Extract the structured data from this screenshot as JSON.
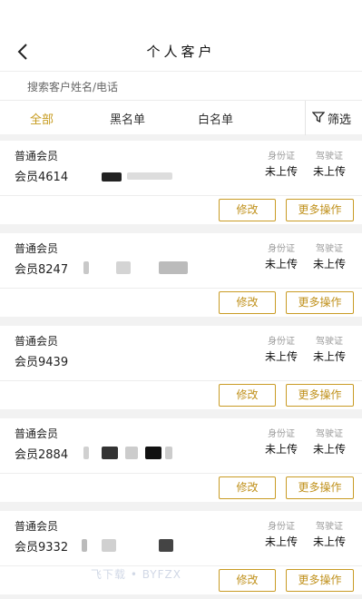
{
  "header": {
    "title": "个人客户"
  },
  "search": {
    "placeholder": "搜索客户姓名/电话"
  },
  "tabs": [
    {
      "label": "全部",
      "active": true
    },
    {
      "label": "黑名单",
      "active": false
    },
    {
      "label": "白名单",
      "active": false
    }
  ],
  "filter": {
    "label": "筛选"
  },
  "doc_labels": {
    "id_card": "身份证",
    "driver_license": "驾驶证"
  },
  "buttons": {
    "edit": "修改",
    "more": "更多操作"
  },
  "customers": [
    {
      "level": "普通会员",
      "name": "会员4614",
      "id_card_status": "未上传",
      "driver_license_status": "未上传"
    },
    {
      "level": "普通会员",
      "name": "会员8247",
      "id_card_status": "未上传",
      "driver_license_status": "未上传"
    },
    {
      "level": "普通会员",
      "name": "会员9439",
      "id_card_status": "未上传",
      "driver_license_status": "未上传"
    },
    {
      "level": "普通会员",
      "name": "会员2884",
      "id_card_status": "未上传",
      "driver_license_status": "未上传"
    },
    {
      "level": "普通会员",
      "name": "会员9332",
      "id_card_status": "未上传",
      "driver_license_status": "未上传"
    }
  ],
  "watermark": "飞下载 • BYFZX",
  "colors": {
    "accent": "#c69a1d",
    "background": "#f2f2f2"
  }
}
